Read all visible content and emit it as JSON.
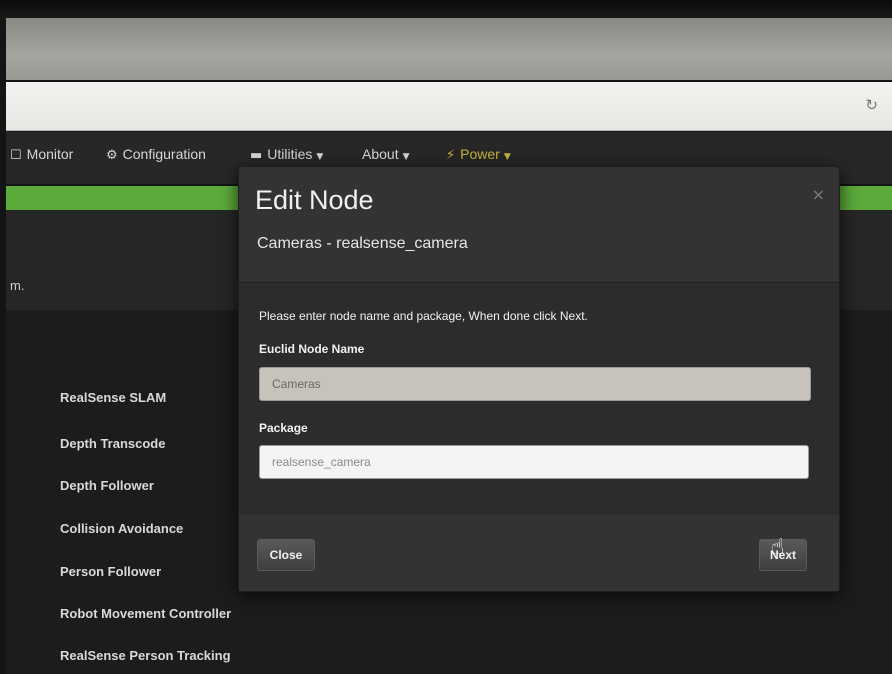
{
  "browser": {
    "reload_icon": "reload-icon"
  },
  "navbar": {
    "items": [
      {
        "icon": "monitor-icon",
        "label": "Monitor"
      },
      {
        "icon": "cogs-icon",
        "label": "Configuration"
      },
      {
        "icon": "briefcase-icon",
        "label": "Utilities",
        "dropdown": true
      },
      {
        "label": "About",
        "dropdown": true
      },
      {
        "icon": "bolt-icon",
        "label": "Power",
        "dropdown": true
      }
    ],
    "power_color": "#c7b33c",
    "accent_bar_color": "#5caa3a"
  },
  "subheader": {
    "text_fragment": "m."
  },
  "node_list": [
    "RealSense SLAM",
    "Depth Transcode",
    "Depth Follower",
    "Collision Avoidance",
    "Person Follower",
    "Robot Movement Controller",
    "RealSense Person Tracking"
  ],
  "modal": {
    "title": "Edit Node",
    "subtitle": "Cameras - realsense_camera",
    "close_symbol": "×",
    "instruction": "Please enter node name and package, When done click Next.",
    "name_label": "Euclid Node Name",
    "name_value": "Cameras",
    "package_label": "Package",
    "package_value": "realsense_camera",
    "close_button": "Close",
    "next_button": "Next"
  }
}
